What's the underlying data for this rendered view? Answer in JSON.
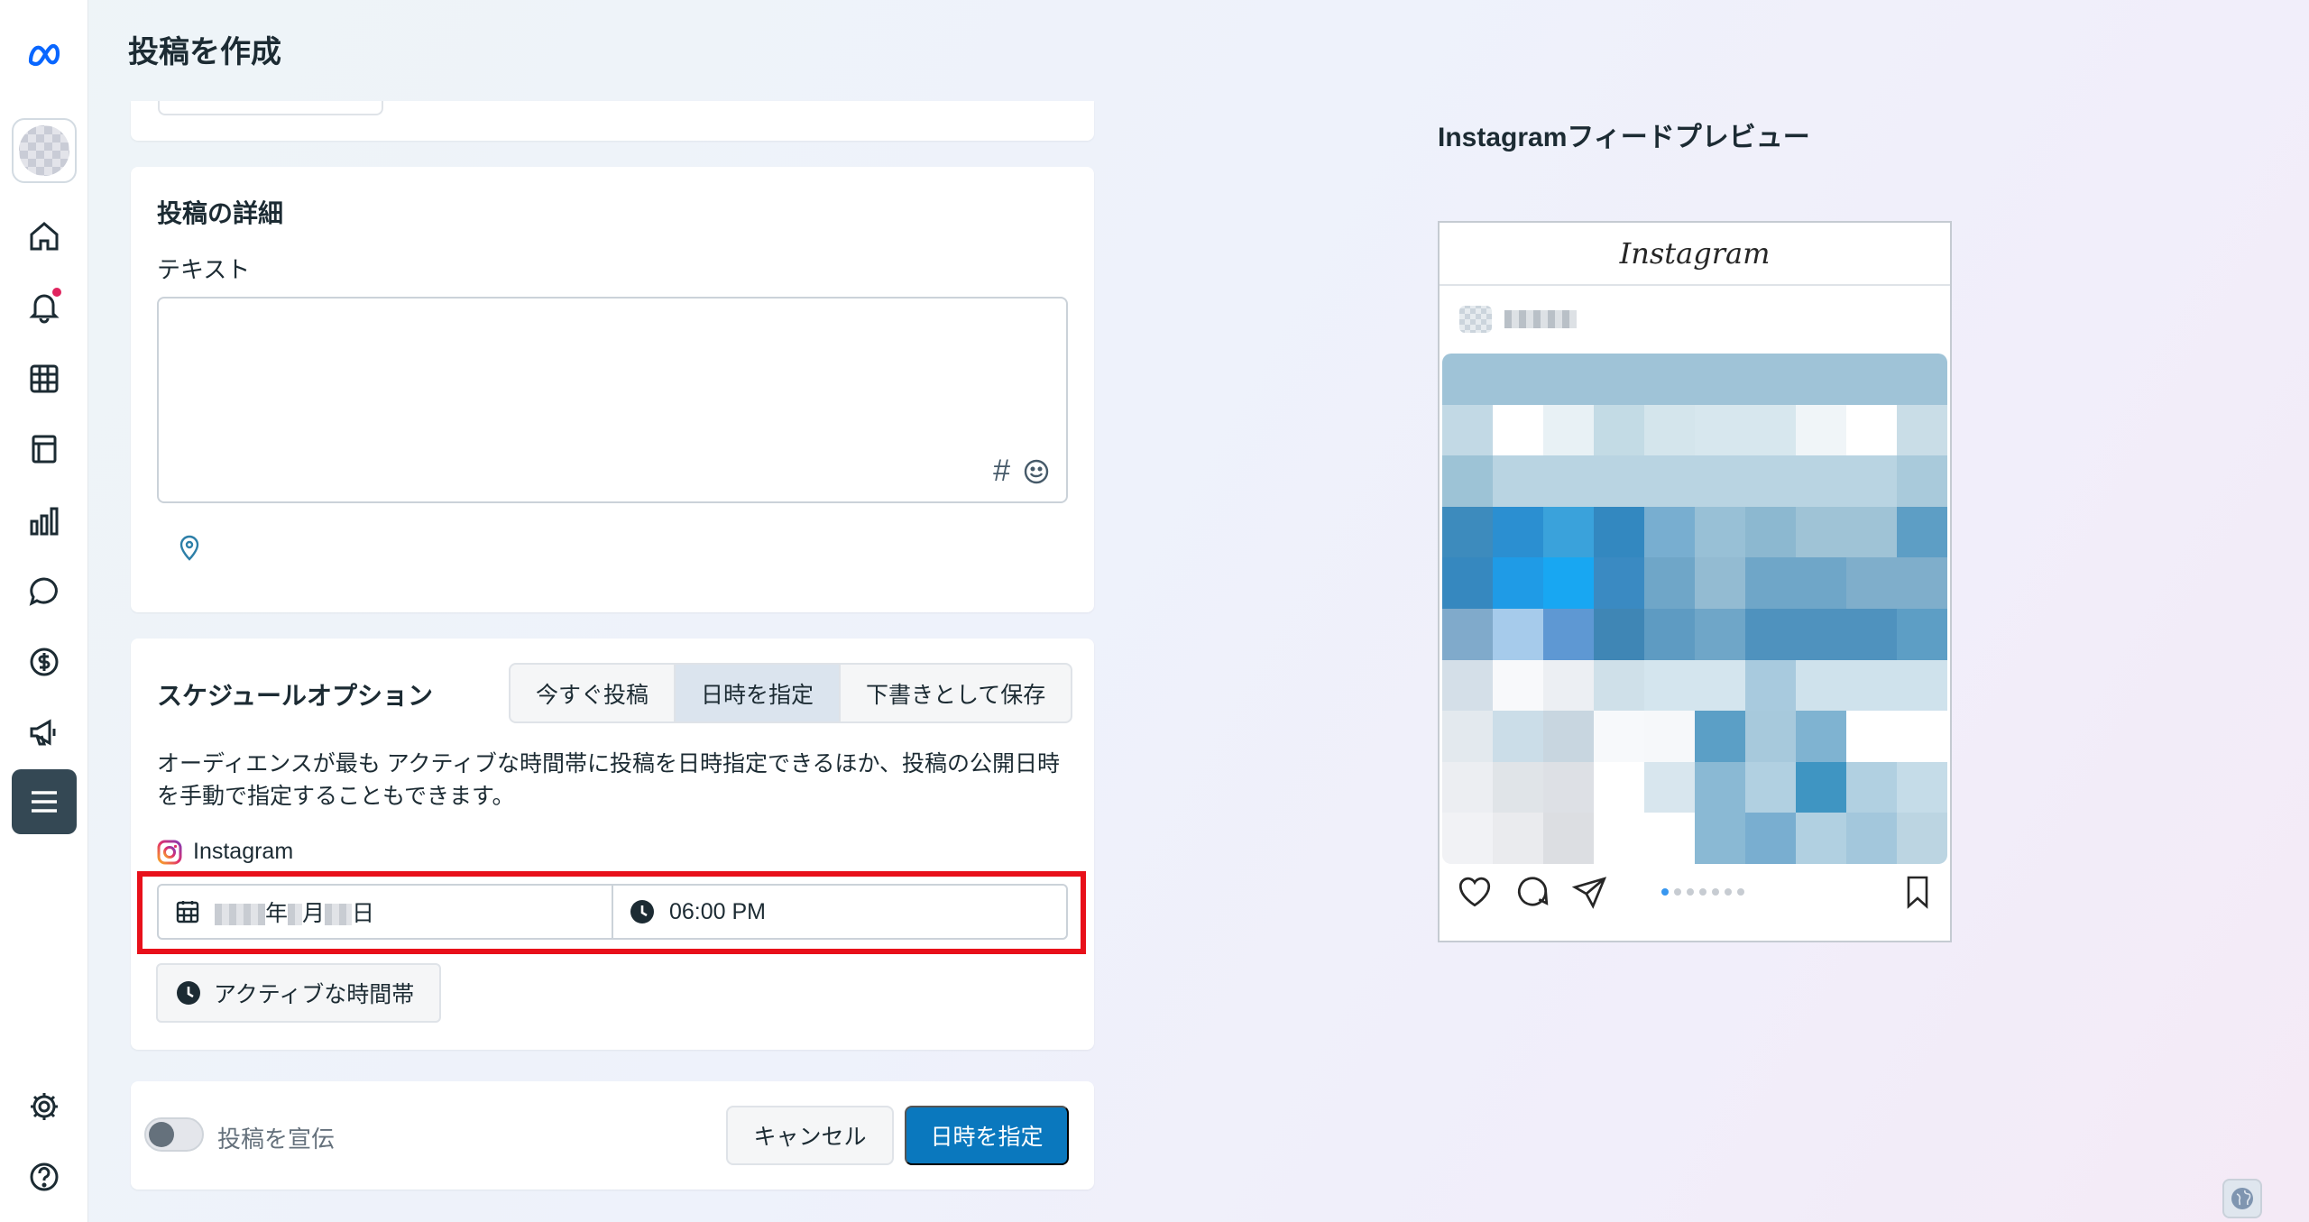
{
  "header": {
    "title": "投稿を作成"
  },
  "sidebar": {
    "items": [
      {
        "icon": "meta-logo-icon"
      },
      {
        "icon": "avatar"
      },
      {
        "icon": "home-icon"
      },
      {
        "icon": "notifications-icon",
        "has_badge": true
      },
      {
        "icon": "table-icon"
      },
      {
        "icon": "content-icon"
      },
      {
        "icon": "insights-icon"
      },
      {
        "icon": "inbox-icon"
      },
      {
        "icon": "monetization-icon"
      },
      {
        "icon": "ads-icon"
      },
      {
        "icon": "all-tools-menu-icon",
        "active": true
      },
      {
        "icon": "settings-icon"
      },
      {
        "icon": "help-icon"
      }
    ]
  },
  "details": {
    "title": "投稿の詳細",
    "text_label": "テキスト",
    "text_value": "",
    "hashtag_symbol": "#"
  },
  "schedule": {
    "title": "スケジュールオプション",
    "options": [
      "今すぐ投稿",
      "日時を指定",
      "下書きとして保存"
    ],
    "selected_option": "日時を指定",
    "description": "オーディエンスが最も アクティブな時間帯に投稿を日時指定できるほか、投稿の公開日時を手動で指定することもできます。",
    "platform": "Instagram",
    "date_year_suffix": "年",
    "date_month_suffix": "月",
    "date_day_suffix": "日",
    "time": "06:00 PM",
    "active_times_label": "アクティブな時間帯"
  },
  "footer": {
    "promote_label": "投稿を宣伝",
    "promote_enabled": false,
    "cancel_label": "キャンセル",
    "schedule_label": "日時を指定"
  },
  "preview": {
    "title": "Instagramフィードプレビュー",
    "app_name": "Instagram",
    "carousel_count": 7,
    "carousel_active_index": 0
  },
  "colors": {
    "primary_button": "#0a78be",
    "highlight": "#e8101a",
    "notification_badge": "#e0245e",
    "active_sidebar": "#344854"
  }
}
